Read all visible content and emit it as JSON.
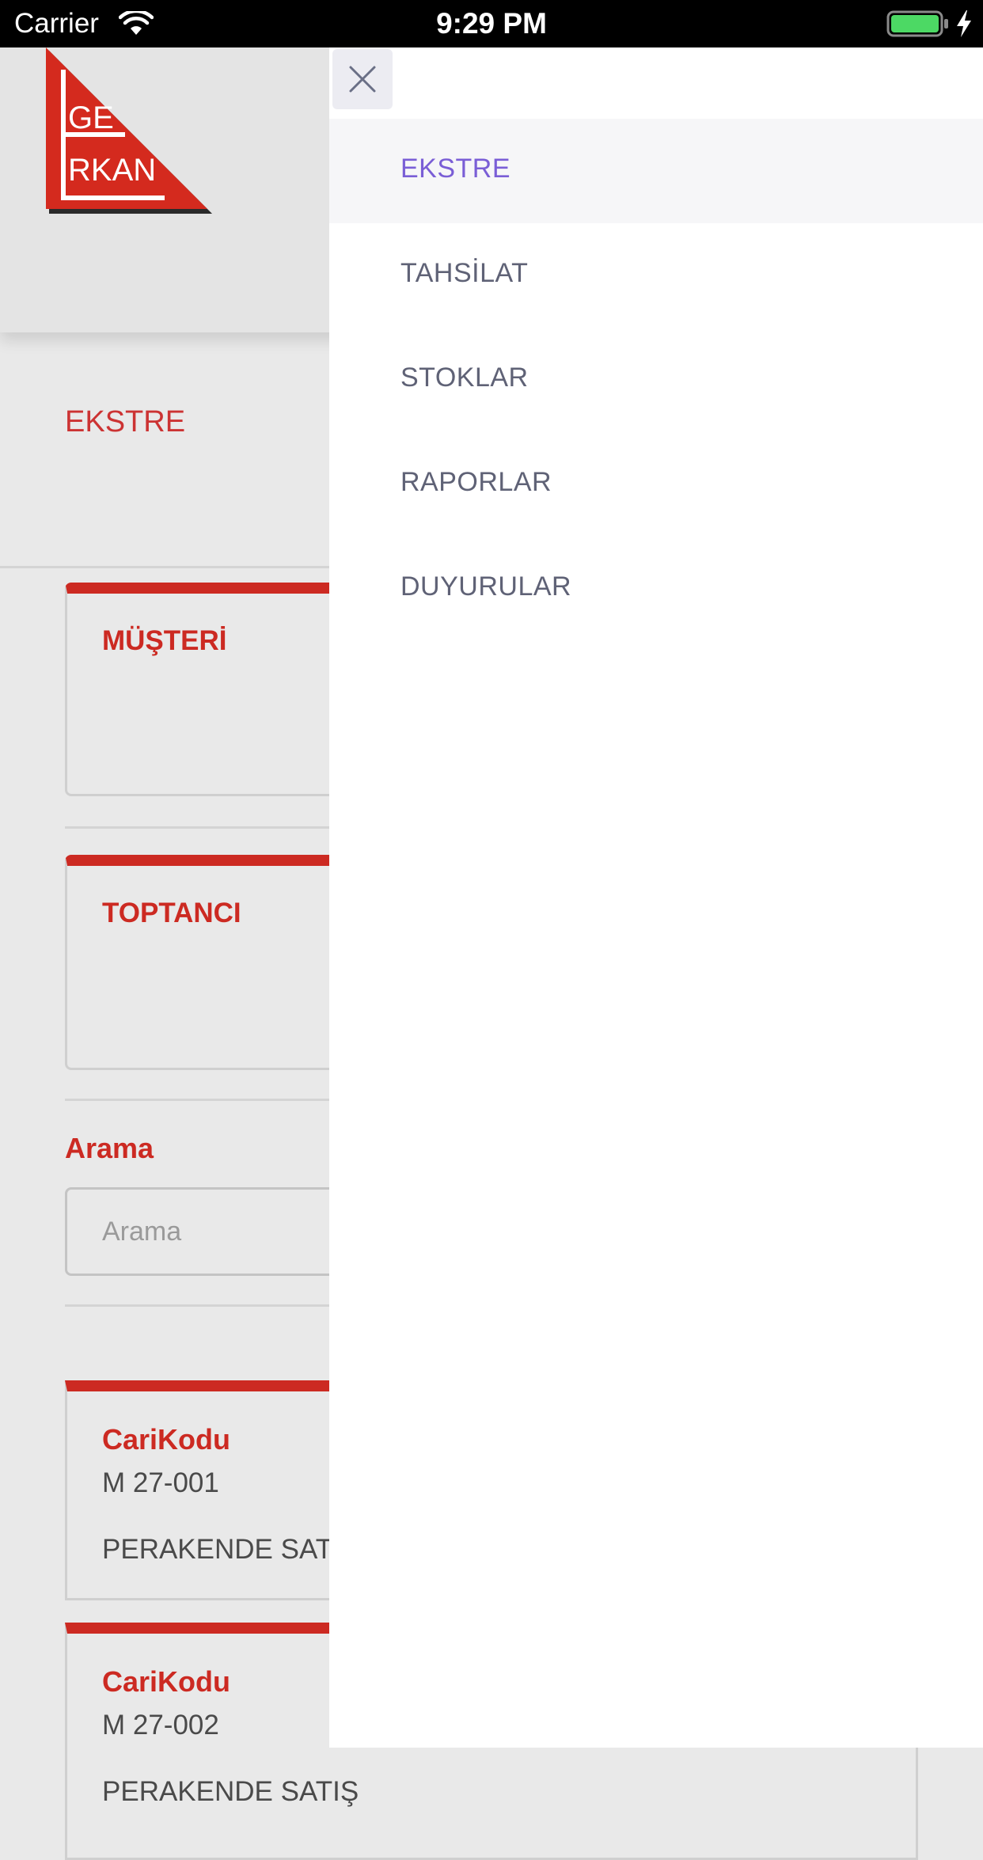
{
  "status_bar": {
    "carrier": "Carrier",
    "time": "9:29 PM"
  },
  "logo": {
    "top_text": "GE",
    "bottom_text": "RKAN"
  },
  "page": {
    "section_title": "EKSTRE",
    "cards": {
      "musteri": "MÜŞTERİ",
      "toptanci": "TOPTANCI"
    },
    "search": {
      "label": "Arama",
      "placeholder": "Arama",
      "value": ""
    },
    "records": [
      {
        "label": "CariKodu",
        "code": "M 27-001",
        "name": "PERAKENDE SATIŞ"
      },
      {
        "label": "CariKodu",
        "code": "M 27-002",
        "name": "PERAKENDE SATIŞ"
      }
    ]
  },
  "drawer": {
    "close_icon": "close-icon",
    "active_index": 0,
    "items": [
      {
        "label": "EKSTRE"
      },
      {
        "label": "TAHSİLAT"
      },
      {
        "label": "STOKLAR"
      },
      {
        "label": "RAPORLAR"
      },
      {
        "label": "DUYURULAR"
      }
    ]
  },
  "colors": {
    "brand_red": "#cc2a22",
    "active_menu": "#7a5ed6",
    "menu_text": "#5f6276"
  }
}
